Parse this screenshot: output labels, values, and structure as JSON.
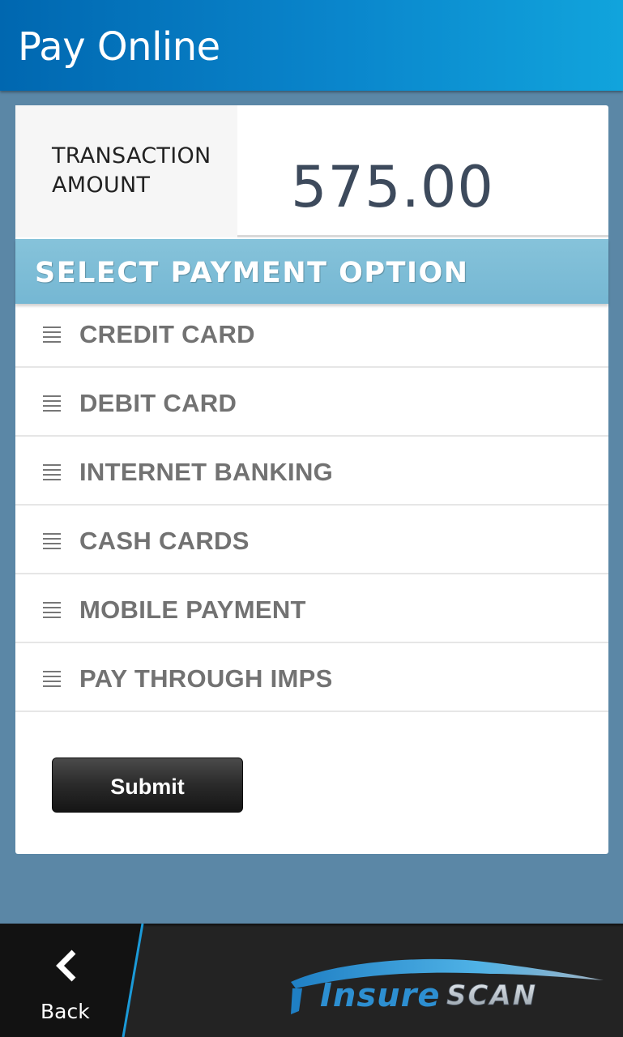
{
  "header": {
    "title": "Pay Online"
  },
  "transaction": {
    "label": "TRANSACTION AMOUNT",
    "amount": "575.00"
  },
  "payment_section": {
    "title": "SELECT PAYMENT OPTION",
    "options": [
      {
        "label": "CREDIT CARD"
      },
      {
        "label": "DEBIT CARD"
      },
      {
        "label": "INTERNET BANKING"
      },
      {
        "label": "CASH CARDS"
      },
      {
        "label": "MOBILE PAYMENT"
      },
      {
        "label": "PAY THROUGH IMPS"
      }
    ]
  },
  "form": {
    "submit_label": "Submit"
  },
  "action_bar": {
    "back_label": "Back",
    "back_icon": "chevron-left-icon",
    "logo_text": "InsureSCAN"
  },
  "colors": {
    "title_bar": "#0a86cc",
    "page_background": "#5b87a6",
    "section_header": "#7bbbd6",
    "option_text": "#727272",
    "amount_text": "#3d4a5c",
    "action_bar": "#232323",
    "accent_line": "#1b9ad8"
  }
}
